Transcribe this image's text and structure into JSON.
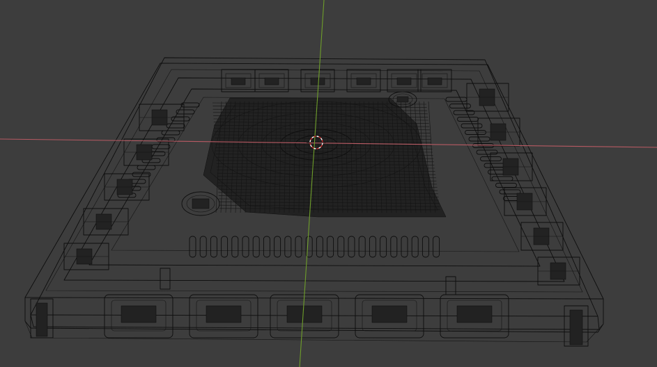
{
  "viewport": {
    "background_color": "#3d3d3d",
    "wire_color": "#0d0d0d",
    "view_mode": "wireframe"
  },
  "axes": {
    "x_axis_color": "#b85a63",
    "y_axis_color": "#6e9e2a"
  },
  "cursor_3d": {
    "icon": "3d-cursor-icon",
    "ring_color": "#c92a2a",
    "inner_ring_color": "#ffffff"
  },
  "object": {
    "name_icon": "mesh-wireframe",
    "description": ""
  }
}
